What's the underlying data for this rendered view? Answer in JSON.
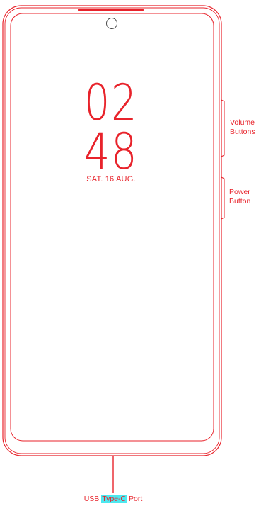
{
  "colors": {
    "outline": "#e8232b",
    "highlight": "#4de8ef",
    "background": "#ffffff"
  },
  "lock_screen": {
    "hours": "02",
    "minutes": "48",
    "date": "SAT. 16  AUG."
  },
  "callouts": {
    "volume": [
      "Volume",
      "Buttons"
    ],
    "power": [
      "Power",
      "Button"
    ],
    "usb": {
      "prefix": "USB",
      "highlighted": "Type-C",
      "suffix": "Port"
    }
  }
}
